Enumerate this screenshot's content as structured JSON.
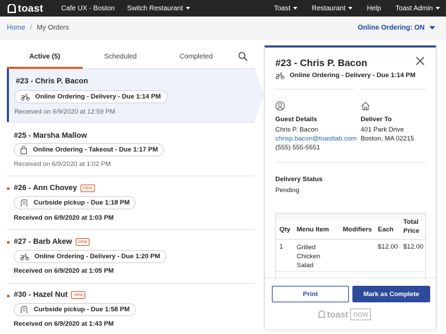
{
  "topnav": {
    "logo_text": "toast",
    "location": "Cafe UX - Boston",
    "switch_restaurant": "Switch Restaurant",
    "right_items": [
      "Toast",
      "Restaurant",
      "Help",
      "Toast Admin"
    ]
  },
  "breadcrumb": {
    "home": "Home",
    "separator": "/",
    "current": "My Orders"
  },
  "online_ordering_status": "Online Ordering: ON",
  "tabs": [
    {
      "label": "Active (5)",
      "active": true
    },
    {
      "label": "Scheduled",
      "active": false
    },
    {
      "label": "Completed",
      "active": false
    }
  ],
  "orders": [
    {
      "title": "#23 - Chris P. Bacon",
      "is_new": false,
      "icon": "scooter-icon",
      "type": "Online Ordering - Delivery - Due 1:14 PM",
      "received": "Received on 6/9/2020 at 12:59 PM",
      "selected": true,
      "unread": false
    },
    {
      "title": "#25 - Marsha Mallow",
      "is_new": false,
      "icon": "bag-icon",
      "type": "Online Ordering - Takeout - Due 1:17 PM",
      "received": "Received on 6/9/2020 at 1:02 PM",
      "selected": false,
      "unread": false
    },
    {
      "title": "#26 - Ann Chovey",
      "is_new": true,
      "icon": "car-icon",
      "type": "Curbside pickup - Due 1:18 PM",
      "received": "Received on 6/9/2020 at 1:03 PM",
      "selected": false,
      "unread": true
    },
    {
      "title": "#27 - Barb Akew",
      "is_new": true,
      "icon": "scooter-icon",
      "type": "Online Ordering - Delivery - Due 1:20 PM",
      "received": "Received on 6/9/2020 at 1:05 PM",
      "selected": false,
      "unread": true
    },
    {
      "title": "#30 - Hazel Nut",
      "is_new": true,
      "icon": "car-icon",
      "type": "Curbside pickup - Due 1:58 PM",
      "received": "Received on 6/9/2020 at 1:43 PM",
      "selected": false,
      "unread": true
    }
  ],
  "new_badge": "new",
  "detail": {
    "title": "#23 - Chris P. Bacon",
    "type": "Online Ordering - Delivery - Due 1:14 PM",
    "guest_details_label": "Guest Details",
    "guest_name": "Chris P. Bacon",
    "guest_email": "chrisp.bacon@toasttab.com",
    "guest_phone": "(555) 555-5551",
    "deliver_to_label": "Deliver To",
    "address_line1": "401 Park Drive",
    "address_line2": "Boston, MA 02215",
    "delivery_status_label": "Delivery Status",
    "delivery_status": "Pending",
    "table": {
      "headers": [
        "Qty",
        "Menu Item",
        "Modifiers",
        "Each",
        "Total Price"
      ],
      "rows": [
        {
          "qty": "1",
          "item": "Grilled Chicken Salad",
          "modifiers": "",
          "each": "$12.00",
          "total": "$12.00"
        }
      ]
    },
    "print_label": "Print",
    "complete_label": "Mark as Complete",
    "brand_toast": "toast",
    "brand_now": "now"
  },
  "colors": {
    "nav_bg": "#252525",
    "accent_orange": "#e2572b",
    "primary_blue": "#2c4b9b",
    "link_blue": "#2b64b5",
    "selected_bg": "#eef2fa"
  }
}
